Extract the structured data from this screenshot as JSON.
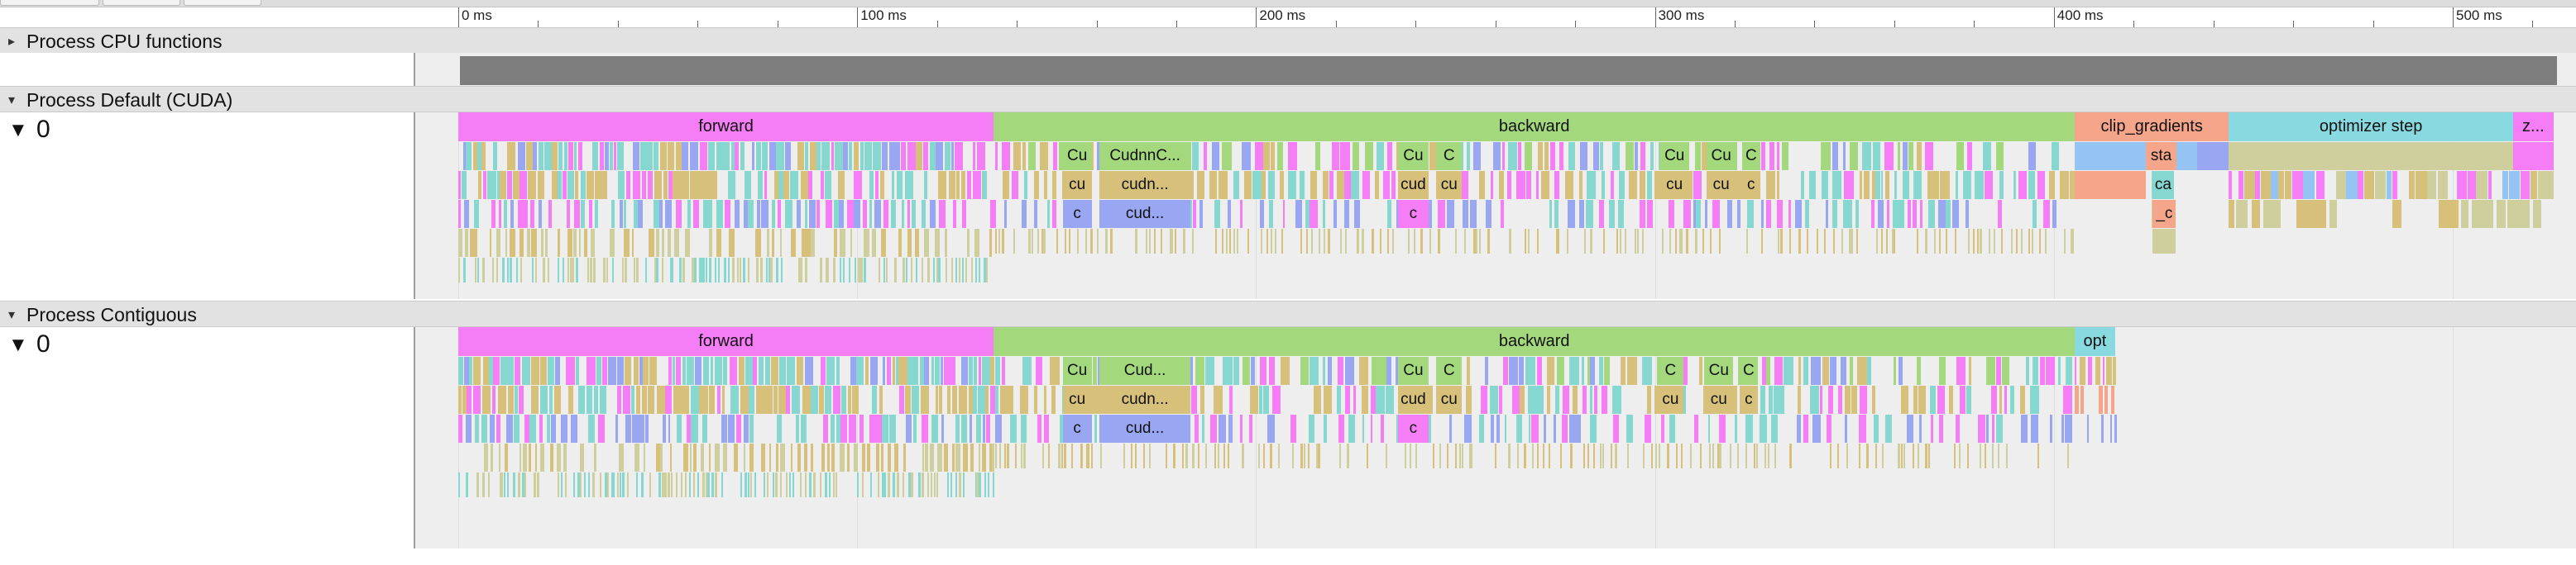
{
  "ruler": {
    "ticks": [
      {
        "label": "0 ms",
        "ms": 0
      },
      {
        "label": "100 ms",
        "ms": 100
      },
      {
        "label": "200 ms",
        "ms": 200
      },
      {
        "label": "300 ms",
        "ms": 300
      },
      {
        "label": "400 ms",
        "ms": 400
      },
      {
        "label": "500 ms",
        "ms": 500
      }
    ]
  },
  "colors": {
    "forward": "#f57ef6",
    "backward": "#a3d97c",
    "clip": "#f4a58a",
    "optimizer": "#88d9e0",
    "zero": "#f57ef6",
    "cpu_bar": "#7d7d7d",
    "blue": "#99a6f2",
    "tan": "#d6c07a",
    "teal": "#86d7cf",
    "lightblue": "#93c4f4",
    "salmon": "#f4a58a",
    "olive": "#cfcf9e"
  },
  "processes": [
    {
      "toggle": "▸",
      "name": "Process CPU functions"
    },
    {
      "toggle": "▾",
      "name": "Process Default (CUDA)"
    },
    {
      "toggle": "▾",
      "name": "Process Contiguous"
    }
  ],
  "threads": [
    {
      "toggle": "▼",
      "name": "0"
    },
    {
      "toggle": "▼",
      "name": "0"
    }
  ],
  "cuda": {
    "top": [
      {
        "label": "forward",
        "start": 0,
        "end": 134.2,
        "color": "forward"
      },
      {
        "label": "backward",
        "start": 134.2,
        "end": 405.3,
        "color": "backward"
      },
      {
        "label": "clip_gradients",
        "start": 405.3,
        "end": 443.8,
        "color": "clip"
      },
      {
        "label": "optimizer step",
        "start": 443.8,
        "end": 515.2,
        "color": "optimizer"
      },
      {
        "label": "z...",
        "start": 515.2,
        "end": 525.2,
        "color": "zero"
      }
    ],
    "subs": [
      {
        "label": "Cu",
        "start": 151.5,
        "end": 158.8,
        "row": 1,
        "color": "backward"
      },
      {
        "label": "CudnnC...",
        "start": 160.8,
        "end": 183.5,
        "row": 1,
        "color": "backward"
      },
      {
        "label": "Cu",
        "start": 235.6,
        "end": 243.2,
        "row": 1,
        "color": "backward"
      },
      {
        "label": "C",
        "start": 245.2,
        "end": 251.6,
        "row": 1,
        "color": "backward"
      },
      {
        "label": "Cu",
        "start": 301.2,
        "end": 308.6,
        "row": 1,
        "color": "backward"
      },
      {
        "label": "Cu",
        "start": 313.0,
        "end": 320.2,
        "row": 1,
        "color": "backward"
      },
      {
        "label": "C",
        "start": 321.8,
        "end": 326.4,
        "row": 1,
        "color": "backward"
      },
      {
        "label": "sta",
        "start": 423.0,
        "end": 430.8,
        "row": 1,
        "color": "clip"
      },
      {
        "label": "cu",
        "start": 151.5,
        "end": 158.8,
        "row": 2,
        "color": "tan"
      },
      {
        "label": "cudn...",
        "start": 160.8,
        "end": 183.5,
        "row": 2,
        "color": "tan"
      },
      {
        "label": "cud",
        "start": 235.6,
        "end": 243.2,
        "row": 2,
        "color": "tan"
      },
      {
        "label": "cu",
        "start": 245.2,
        "end": 251.6,
        "row": 2,
        "color": "tan"
      },
      {
        "label": "cu",
        "start": 301.2,
        "end": 308.6,
        "row": 2,
        "color": "tan"
      },
      {
        "label": "cu",
        "start": 313.0,
        "end": 320.2,
        "row": 2,
        "color": "tan"
      },
      {
        "label": "c",
        "start": 321.8,
        "end": 326.4,
        "row": 2,
        "color": "tan"
      },
      {
        "label": "ca",
        "start": 424.6,
        "end": 430.2,
        "row": 2,
        "color": "teal"
      },
      {
        "label": "c",
        "start": 151.5,
        "end": 158.8,
        "row": 3,
        "color": "blue"
      },
      {
        "label": "cud...",
        "start": 160.8,
        "end": 183.5,
        "row": 3,
        "color": "blue"
      },
      {
        "label": "c",
        "start": 235.6,
        "end": 243.2,
        "row": 3,
        "color": "forward"
      },
      {
        "label": "_c",
        "start": 424.8,
        "end": 430.6,
        "row": 3,
        "color": "clip"
      }
    ]
  },
  "contig": {
    "top": [
      {
        "label": "forward",
        "start": 0,
        "end": 134.2,
        "color": "forward"
      },
      {
        "label": "backward",
        "start": 134.2,
        "end": 405.3,
        "color": "backward"
      },
      {
        "label": "opt",
        "start": 405.3,
        "end": 415.3,
        "color": "optimizer"
      }
    ],
    "subs": [
      {
        "label": "Cu",
        "start": 151.5,
        "end": 158.8,
        "row": 1,
        "color": "backward"
      },
      {
        "label": "Cud...",
        "start": 160.8,
        "end": 183.5,
        "row": 1,
        "color": "backward"
      },
      {
        "label": "Cu",
        "start": 235.6,
        "end": 243.2,
        "row": 1,
        "color": "backward"
      },
      {
        "label": "C",
        "start": 245.2,
        "end": 251.6,
        "row": 1,
        "color": "backward"
      },
      {
        "label": "C",
        "start": 300.6,
        "end": 307.2,
        "row": 1,
        "color": "backward"
      },
      {
        "label": "Cu",
        "start": 312.4,
        "end": 319.6,
        "row": 1,
        "color": "backward"
      },
      {
        "label": "C",
        "start": 321.2,
        "end": 325.8,
        "row": 1,
        "color": "backward"
      },
      {
        "label": "cu",
        "start": 151.5,
        "end": 158.8,
        "row": 2,
        "color": "tan"
      },
      {
        "label": "cudn...",
        "start": 160.8,
        "end": 183.5,
        "row": 2,
        "color": "tan"
      },
      {
        "label": "cud",
        "start": 235.6,
        "end": 243.2,
        "row": 2,
        "color": "tan"
      },
      {
        "label": "cu",
        "start": 245.2,
        "end": 251.6,
        "row": 2,
        "color": "tan"
      },
      {
        "label": "cu",
        "start": 300.6,
        "end": 307.2,
        "row": 2,
        "color": "tan"
      },
      {
        "label": "cu",
        "start": 312.4,
        "end": 319.6,
        "row": 2,
        "color": "tan"
      },
      {
        "label": "c",
        "start": 321.2,
        "end": 325.8,
        "row": 2,
        "color": "tan"
      },
      {
        "label": "c",
        "start": 151.5,
        "end": 158.8,
        "row": 3,
        "color": "blue"
      },
      {
        "label": "cud...",
        "start": 160.8,
        "end": 183.5,
        "row": 3,
        "color": "blue"
      },
      {
        "label": "c",
        "start": 235.6,
        "end": 243.2,
        "row": 3,
        "color": "forward"
      }
    ]
  }
}
